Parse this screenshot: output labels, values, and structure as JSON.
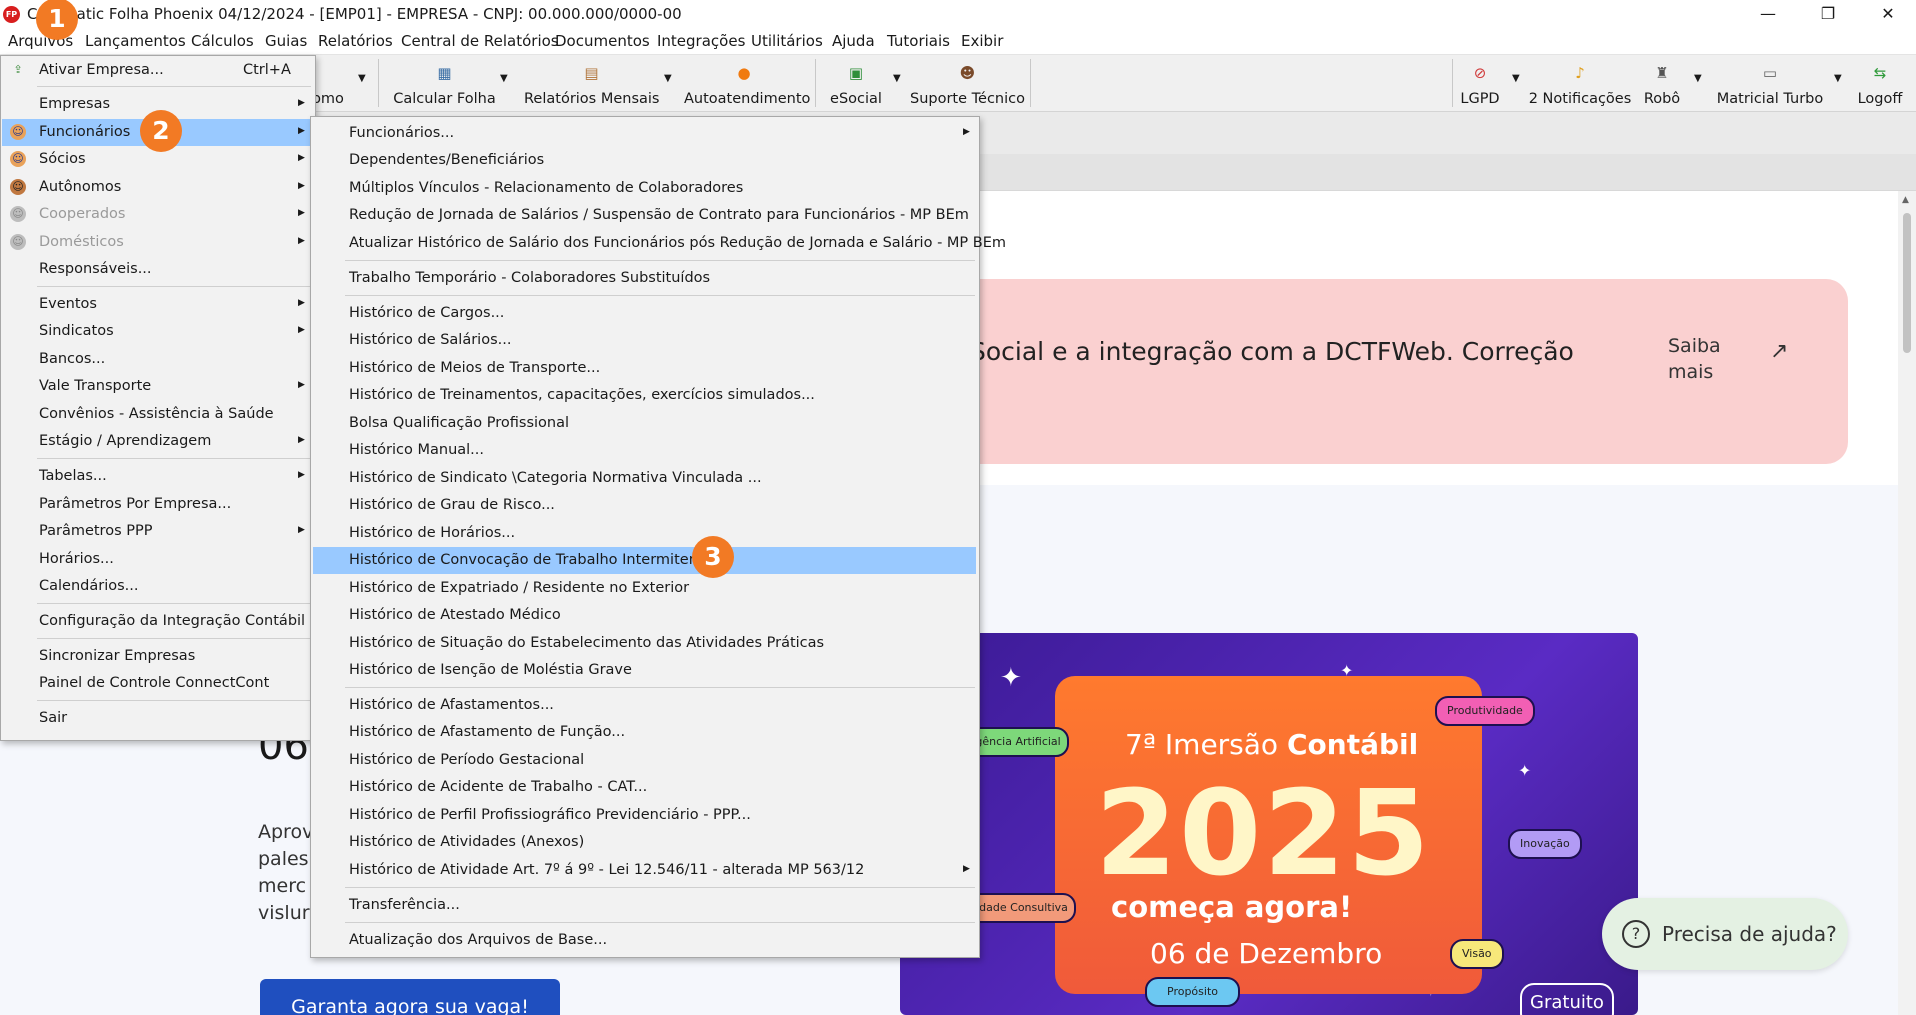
{
  "window": {
    "title": "Contmatic Folha Phoenix 04/12/2024 - [EMP01] - EMPRESA - CNPJ: 00.000.000/0000-00",
    "logo_text": "FP",
    "controls": [
      "—",
      "❐",
      "✕"
    ]
  },
  "menubar": [
    "Arquivos",
    "Lançamentos",
    "Cálculos",
    "Guias",
    "Relatórios",
    "Central de Relatórios",
    "Documentos",
    "Integrações",
    "Utilitários",
    "Ajuda",
    "Tutoriais",
    "Exibir"
  ],
  "toolbar": {
    "partial_label": "omo",
    "buttons": [
      "Calcular Folha",
      "Relatórios Mensais",
      "Autoatendimento",
      "eSocial",
      "Suporte Técnico",
      "LGPD",
      "2 Notificações",
      "Robô",
      "Matricial Turbo",
      "Logoff"
    ]
  },
  "banner": {
    "text": "Social e a integração com a DCTFWeb. Correção",
    "link": "Saiba mais",
    "arrow": "↗"
  },
  "promo": {
    "big_date": "06",
    "text_fragment": "Aprov\npales\nmerc\nvislur",
    "cta": "Garanta agora sua vaga!",
    "event_prefix": "7ª Imersão",
    "event_brand": "Contábil",
    "event_year": "2025",
    "event_slogan": "começa agora!",
    "event_date": "06 de Dezembro",
    "tags": [
      "Produtividade",
      "Inteligência Artificial",
      "Inovação",
      "Habilidade Consultiva",
      "Visão",
      "Propósito"
    ],
    "badge": "Gratuito"
  },
  "help": {
    "icon": "?",
    "label": "Precisa de ajuda?"
  },
  "arquivos_menu": {
    "items": [
      {
        "label": "Ativar Empresa...",
        "shortcut": "Ctrl+A",
        "icon": "⇪",
        "submenu": false
      },
      {
        "label": "Empresas",
        "submenu": true
      },
      {
        "label": "Funcionários",
        "icon": "☺",
        "submenu": true,
        "selected": true
      },
      {
        "label": "Sócios",
        "icon": "☺",
        "submenu": true
      },
      {
        "label": "Autônomos",
        "icon": "☺",
        "submenu": true
      },
      {
        "label": "Cooperados",
        "icon": "☺",
        "submenu": true,
        "disabled": true
      },
      {
        "label": "Domésticos",
        "icon": "☺",
        "submenu": true,
        "disabled": true
      },
      {
        "label": "Responsáveis...",
        "submenu": false
      },
      {
        "label": "Eventos",
        "submenu": true
      },
      {
        "label": "Sindicatos",
        "submenu": true
      },
      {
        "label": "Bancos...",
        "submenu": false
      },
      {
        "label": "Vale Transporte",
        "submenu": true
      },
      {
        "label": "Convênios - Assistência à Saúde",
        "submenu": false
      },
      {
        "label": "Estágio / Aprendizagem",
        "submenu": true
      },
      {
        "label": "Tabelas...",
        "submenu": true
      },
      {
        "label": "Parâmetros Por Empresa...",
        "submenu": false
      },
      {
        "label": "Parâmetros PPP",
        "submenu": true
      },
      {
        "label": "Horários...",
        "submenu": false
      },
      {
        "label": "Calendários...",
        "submenu": false
      },
      {
        "label": "Configuração da Integração Contábil",
        "submenu": false
      },
      {
        "label": "Sincronizar Empresas",
        "submenu": false
      },
      {
        "label": "Painel de Controle ConnectCont",
        "submenu": false
      },
      {
        "label": "Sair",
        "submenu": false
      }
    ]
  },
  "funcionarios_menu": {
    "items": [
      {
        "label": "Funcionários...",
        "submenu": true
      },
      {
        "label": "Dependentes/Beneficiários"
      },
      {
        "label": "Múltiplos Vínculos - Relacionamento de Colaboradores"
      },
      {
        "label": "Redução de Jornada de Salários / Suspensão de Contrato para Funcionários - MP BEm"
      },
      {
        "label": "Atualizar Histórico de Salário dos Funcionários pós Redução de Jornada e Salário - MP BEm"
      },
      {
        "label": "Trabalho Temporário - Colaboradores Substituídos"
      },
      {
        "label": "Histórico de Cargos..."
      },
      {
        "label": "Histórico de Salários..."
      },
      {
        "label": "Histórico de Meios de Transporte..."
      },
      {
        "label": "Histórico de Treinamentos, capacitações, exercícios simulados..."
      },
      {
        "label": "Bolsa Qualificação Profissional"
      },
      {
        "label": "Histórico Manual..."
      },
      {
        "label": "Histórico de Sindicato \\Categoria Normativa Vinculada ..."
      },
      {
        "label": "Histórico de Grau de Risco..."
      },
      {
        "label": "Histórico de Horários..."
      },
      {
        "label": "Histórico de Convocação de Trabalho Intermitente",
        "selected": true
      },
      {
        "label": "Histórico de Expatriado / Residente no Exterior"
      },
      {
        "label": "Histórico de Atestado Médico"
      },
      {
        "label": "Histórico de Situação do Estabelecimento das Atividades Práticas"
      },
      {
        "label": "Histórico de Isenção de Moléstia Grave"
      },
      {
        "label": "Histórico de Afastamentos..."
      },
      {
        "label": "Histórico de Afastamento de Função..."
      },
      {
        "label": "Histórico de Período Gestacional"
      },
      {
        "label": "Histórico de Acidente de Trabalho - CAT..."
      },
      {
        "label": "Histórico de Perfil Profissiográfico Previdenciário - PPP..."
      },
      {
        "label": "Histórico de Atividades (Anexos)"
      },
      {
        "label": "Histórico de Atividade Art. 7º á 9º - Lei 12.546/11 - alterada MP 563/12",
        "submenu": true
      },
      {
        "label": "Transferência..."
      },
      {
        "label": "Atualização dos Arquivos de Base..."
      }
    ]
  },
  "markers": [
    "1",
    "2",
    "3"
  ]
}
